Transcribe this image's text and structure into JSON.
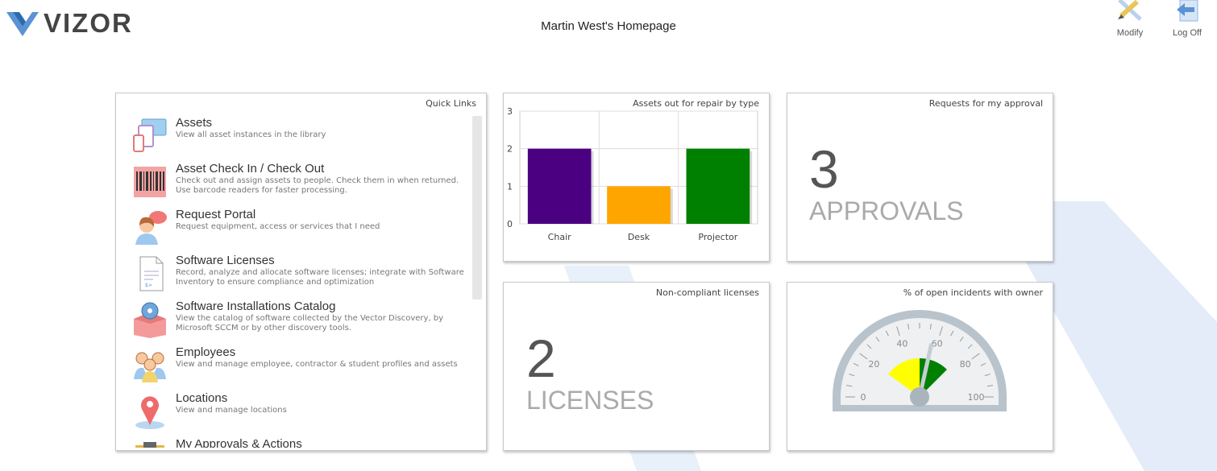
{
  "app": {
    "logo_text": "VIZOR",
    "page_title": "Martin West's Homepage"
  },
  "header_buttons": {
    "modify_label": "Modify",
    "logoff_label": "Log Off"
  },
  "quick_links": {
    "title": "Quick Links",
    "items": [
      {
        "title": "Assets",
        "desc1": "View all asset instances in the library",
        "desc2": "",
        "icon": "devices-icon"
      },
      {
        "title": "Asset Check In / Check Out",
        "desc1": "Check out and assign assets to people. Check them in when returned.",
        "desc2": "Use barcode readers for faster processing.",
        "icon": "barcode-icon"
      },
      {
        "title": "Request Portal",
        "desc1": "Request equipment, access or services that I need",
        "desc2": "",
        "icon": "person-chat-icon"
      },
      {
        "title": "Software Licenses",
        "desc1": "Record, analyze and allocate software licenses; integrate with Software",
        "desc2": "Inventory to ensure compliance and optimization",
        "icon": "document-icon"
      },
      {
        "title": "Software Installations Catalog",
        "desc1": "View the catalog of software collected by the Vector Discovery, by",
        "desc2": "Microsoft SCCM or by other discovery tools.",
        "icon": "disc-box-icon"
      },
      {
        "title": "Employees",
        "desc1": "View and manage employee, contractor & student profiles and assets",
        "desc2": "",
        "icon": "people-icon"
      },
      {
        "title": "Locations",
        "desc1": "View and manage locations",
        "desc2": "",
        "icon": "map-pin-icon"
      },
      {
        "title": "My Approvals & Actions",
        "desc1": "",
        "desc2": "",
        "icon": "clipboard-icon"
      }
    ]
  },
  "repair_chart": {
    "title": "Assets out for repair by type",
    "chart_data": {
      "type": "bar",
      "categories": [
        "Chair",
        "Desk",
        "Projector"
      ],
      "values": [
        2,
        1,
        2
      ],
      "colors": [
        "#4b0082",
        "#ffa500",
        "#008000"
      ],
      "yticks": [
        "0",
        "1",
        "2",
        "3"
      ],
      "ylim": [
        0,
        3
      ]
    }
  },
  "approvals": {
    "title": "Requests for my approval",
    "count": "3",
    "label": "APPROVALS"
  },
  "licenses": {
    "title": "Non-compliant licenses",
    "count": "2",
    "label": "LICENSES"
  },
  "gauge": {
    "title": "% of open incidents with owner",
    "ticks": [
      "0",
      "20",
      "40",
      "60",
      "80",
      "100"
    ],
    "value": 57,
    "bands": [
      {
        "from": 20,
        "to": 50,
        "color": "#ffff00"
      },
      {
        "from": 50,
        "to": 75,
        "color": "#008000"
      }
    ]
  }
}
